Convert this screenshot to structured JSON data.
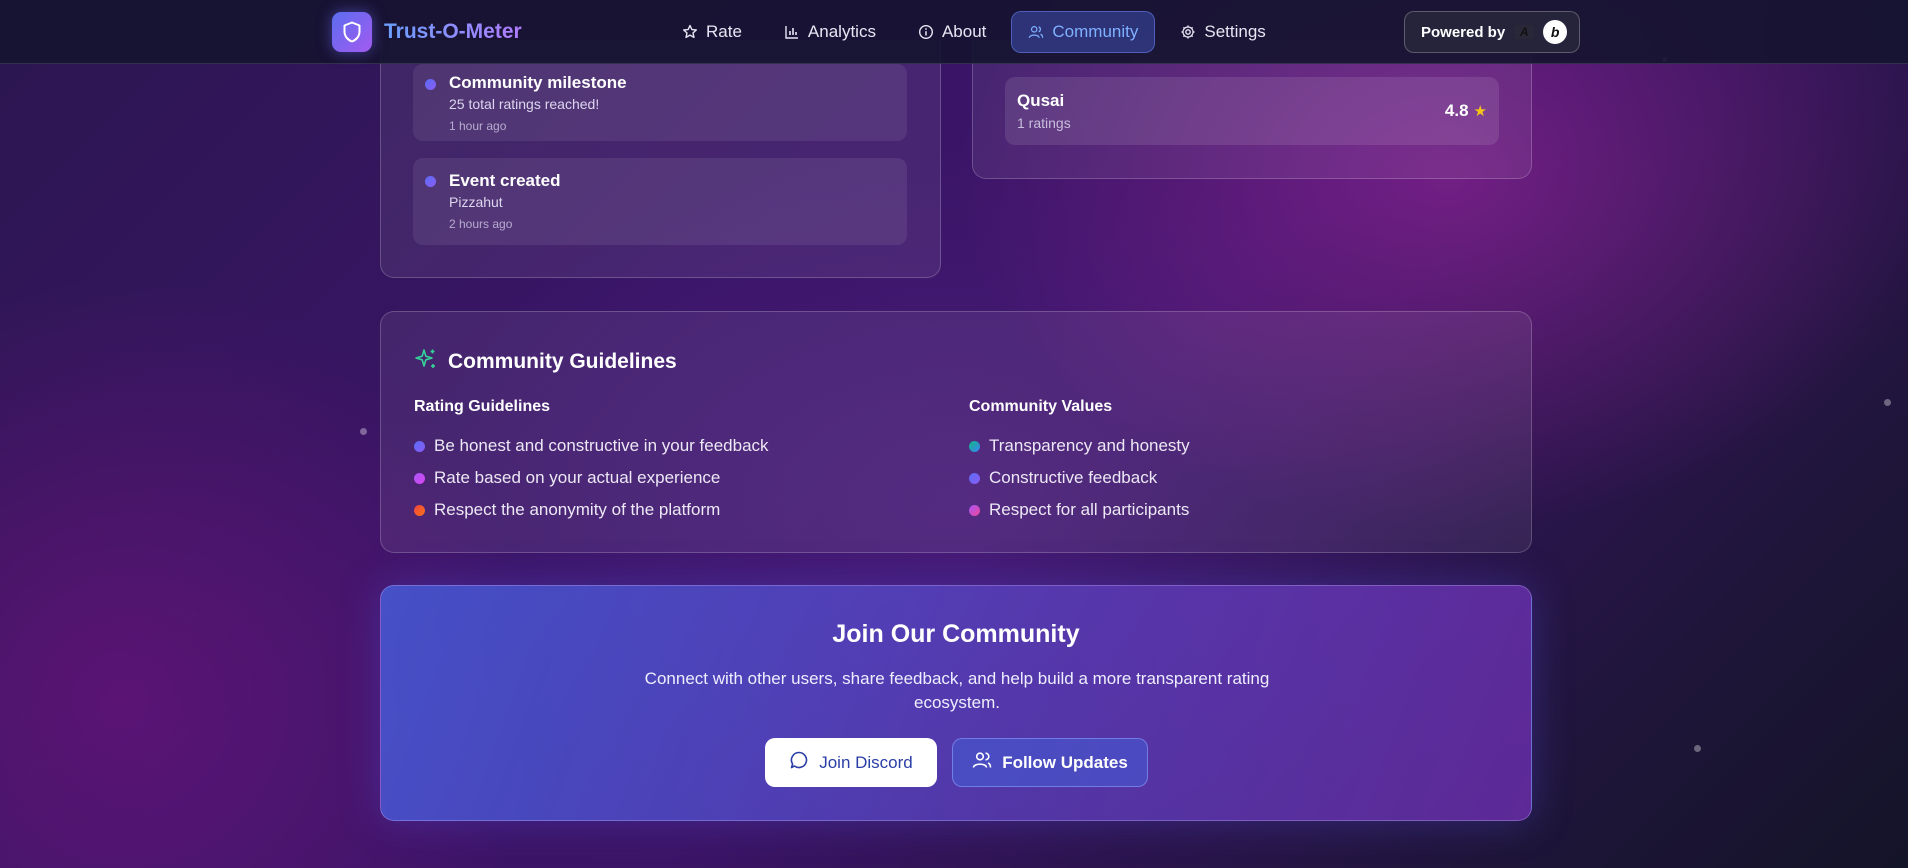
{
  "nav": {
    "brand": "Trust-O-Meter",
    "items": [
      {
        "label": "Rate",
        "icon": "star-icon"
      },
      {
        "label": "Analytics",
        "icon": "bar-chart-icon"
      },
      {
        "label": "About",
        "icon": "info-icon"
      },
      {
        "label": "Community",
        "icon": "users-icon",
        "active": true
      },
      {
        "label": "Settings",
        "icon": "gear-icon"
      }
    ],
    "powered_by": "Powered by",
    "powered_a": "A",
    "powered_b": "b"
  },
  "activity": {
    "items": [
      {
        "title": "Community milestone",
        "description": "25 total ratings reached!",
        "time": "1 hour ago"
      },
      {
        "title": "Event created",
        "description": "Pizzahut",
        "time": "2 hours ago"
      }
    ]
  },
  "top_users": {
    "items": [
      {
        "name": "Qusai",
        "count": "1 ratings",
        "score": "4.8",
        "star": "★"
      }
    ]
  },
  "guidelines": {
    "title": "Community Guidelines",
    "rating": {
      "heading": "Rating Guidelines",
      "items": [
        "Be honest and constructive in your feedback",
        "Rate based on your actual experience",
        "Respect the anonymity of the platform"
      ]
    },
    "values": {
      "heading": "Community Values",
      "items": [
        "Transparency and honesty",
        "Constructive feedback",
        "Respect for all participants"
      ]
    }
  },
  "join": {
    "title": "Join Our Community",
    "description": "Connect with other users, share feedback, and help build a more transparent rating ecosystem.",
    "discord_label": "Join Discord",
    "follow_label": "Follow Updates"
  },
  "colors": {
    "accent": "#7fb0ff",
    "star": "#f5c518",
    "bullet_indigo": "#5a6cf5",
    "bullet_pink": "#c43fd0",
    "bullet_red": "#ef4444",
    "bullet_teal": "#14b8a6"
  }
}
